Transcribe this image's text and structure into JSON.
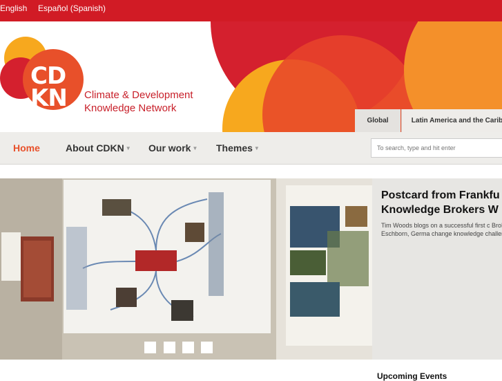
{
  "languages": [
    "English",
    "Español (Spanish)"
  ],
  "logo": {
    "abbr_top": "CD",
    "abbr_bottom": "KN",
    "line1": "Climate & Development",
    "line2": "Knowledge Network"
  },
  "region_tabs": [
    "Global",
    "Latin America and the Carib"
  ],
  "nav": {
    "items": [
      "Home",
      "About CDKN",
      "Our work",
      "Themes"
    ],
    "active": "Home",
    "caret": "▼"
  },
  "search": {
    "placeholder": "To search, type and hit enter"
  },
  "feature": {
    "title": "Postcard from Frankfu Knowledge Brokers W",
    "summary": "Tim Woods blogs on a successful first c Brokers Workshop in Eschborn, Germa change knowledge challenges raised by",
    "slides": 4
  },
  "sidebar": {
    "upcoming_heading": "Upcoming Events"
  },
  "colors": {
    "topbar": "#d11b25",
    "accent": "#e8502a",
    "brand_red": "#c8202a",
    "brand_orange": "#f39a1a"
  }
}
